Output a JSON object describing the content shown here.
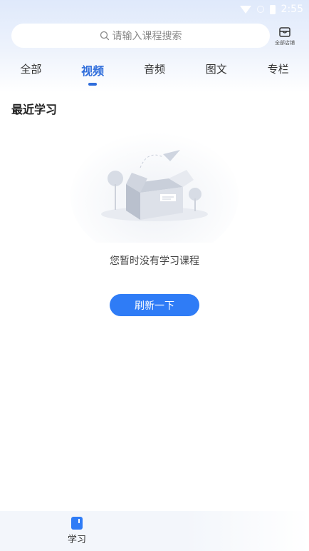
{
  "status_bar": {
    "time": "2:55"
  },
  "search": {
    "placeholder": "请输入课程搜索"
  },
  "store": {
    "label": "全部店铺"
  },
  "tabs": [
    {
      "label": "全部",
      "active": false
    },
    {
      "label": "视频",
      "active": true
    },
    {
      "label": "音频",
      "active": false
    },
    {
      "label": "图文",
      "active": false
    },
    {
      "label": "专栏",
      "active": false
    }
  ],
  "section": {
    "title": "最近学习"
  },
  "empty_state": {
    "message": "您暂时没有学习课程",
    "button_label": "刷新一下"
  },
  "bottom_nav": {
    "items": [
      {
        "label": "学习",
        "icon": "book-icon",
        "active": true
      }
    ]
  },
  "colors": {
    "accent": "#2f6ddb",
    "button": "#2f7cf6"
  }
}
